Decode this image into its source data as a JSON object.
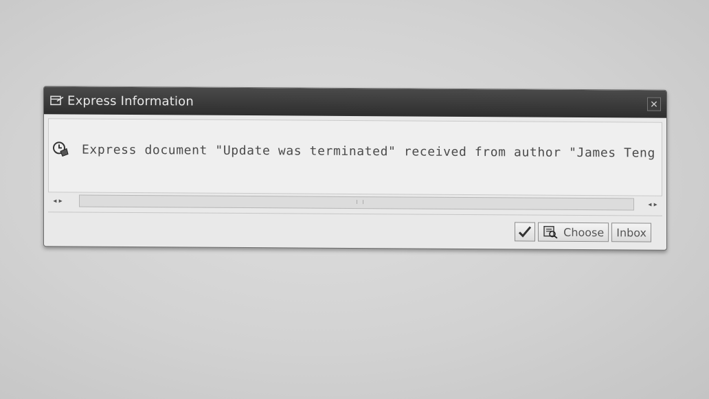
{
  "dialog": {
    "title": "Express Information",
    "close_glyph": "✕",
    "message": "Express document \"Update was terminated\" received from author \"James Teng Chye N",
    "message_icon": "express-document-clock-icon",
    "scroll_left": "◂ ▸",
    "scroll_right": "◂ ▸",
    "buttons": {
      "ok_icon": "checkmark-icon",
      "choose_label": "Choose",
      "choose_icon": "display-document-icon",
      "inbox_label": "Inbox"
    }
  }
}
